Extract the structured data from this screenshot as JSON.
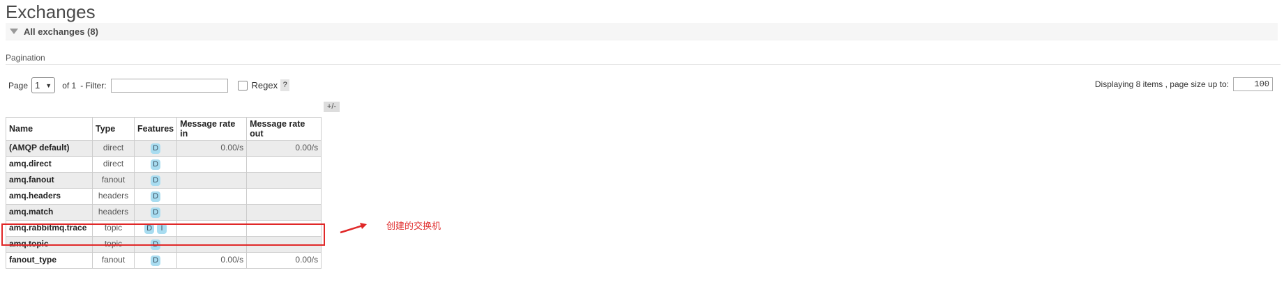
{
  "page_title": "Exchanges",
  "section": {
    "title": "All exchanges (8)"
  },
  "pagination": {
    "label": "Pagination",
    "page_label": "Page",
    "page_value": "1",
    "of_label": "of 1",
    "filter_label": "- Filter:",
    "filter_value": "",
    "regex_label": "Regex",
    "help_label": "?",
    "display_label": "Displaying 8 items , page size up to:",
    "page_size": "100"
  },
  "table": {
    "headers": [
      "Name",
      "Type",
      "Features",
      "Message rate in",
      "Message rate out"
    ],
    "toggle_label": "+/-",
    "rows": [
      {
        "name": "(AMQP default)",
        "type": "direct",
        "features": [
          "D"
        ],
        "rate_in": "0.00/s",
        "rate_out": "0.00/s"
      },
      {
        "name": "amq.direct",
        "type": "direct",
        "features": [
          "D"
        ],
        "rate_in": "",
        "rate_out": ""
      },
      {
        "name": "amq.fanout",
        "type": "fanout",
        "features": [
          "D"
        ],
        "rate_in": "",
        "rate_out": ""
      },
      {
        "name": "amq.headers",
        "type": "headers",
        "features": [
          "D"
        ],
        "rate_in": "",
        "rate_out": ""
      },
      {
        "name": "amq.match",
        "type": "headers",
        "features": [
          "D"
        ],
        "rate_in": "",
        "rate_out": ""
      },
      {
        "name": "amq.rabbitmq.trace",
        "type": "topic",
        "features": [
          "D",
          "I"
        ],
        "rate_in": "",
        "rate_out": ""
      },
      {
        "name": "amq.topic",
        "type": "topic",
        "features": [
          "D"
        ],
        "rate_in": "",
        "rate_out": ""
      },
      {
        "name": "fanout_type",
        "type": "fanout",
        "features": [
          "D"
        ],
        "rate_in": "0.00/s",
        "rate_out": "0.00/s"
      }
    ]
  },
  "annotation": {
    "text": "创建的交换机",
    "color": "#e03030"
  },
  "colors": {
    "badge": "#a8dcf0",
    "highlight": "#e02828",
    "alt_row": "#ececec"
  },
  "icons": {
    "collapse": "triangle-down-icon",
    "arrow": "red-arrow-icon"
  }
}
